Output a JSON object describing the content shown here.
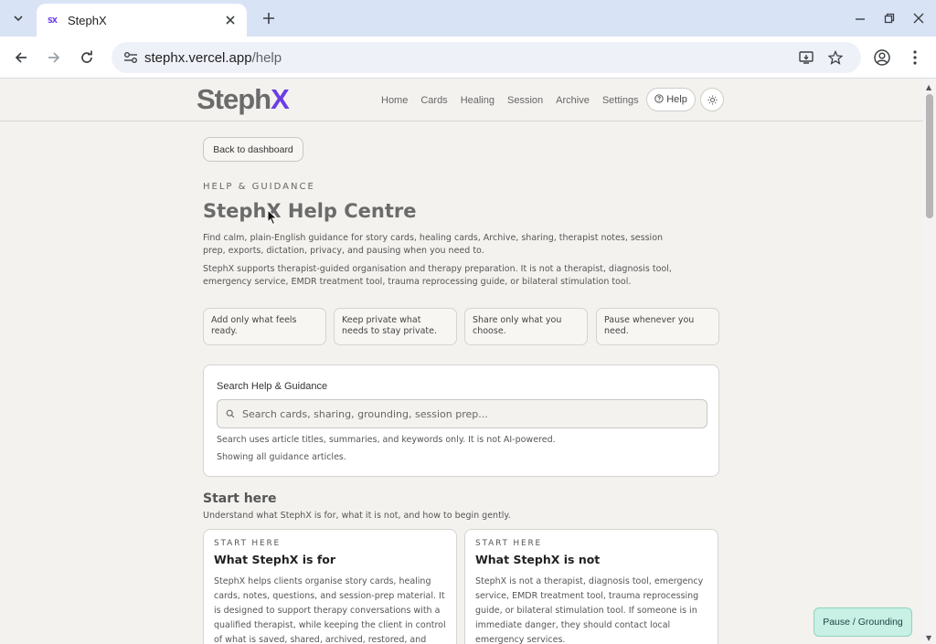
{
  "browser": {
    "tab_title": "StephX",
    "favicon_text": "SX",
    "url_host": "stephx.vercel.app",
    "url_path": "/help"
  },
  "header": {
    "logo_main": "Steph",
    "logo_accent": "X",
    "nav": [
      "Home",
      "Cards",
      "Healing",
      "Session",
      "Archive",
      "Settings"
    ],
    "help_label": "Help"
  },
  "page": {
    "back_label": "Back to dashboard",
    "eyebrow": "HELP & GUIDANCE",
    "title": "StephX Help Centre",
    "intro_1": "Find calm, plain-English guidance for story cards, healing cards, Archive, sharing, therapist notes, session prep, exports, dictation, privacy, and pausing when you need to.",
    "intro_2": "StephX supports therapist-guided organisation and therapy preparation. It is not a therapist, diagnosis tool, emergency service, EMDR treatment tool, trauma reprocessing guide, or bilateral stimulation tool.",
    "pills": [
      "Add only what feels ready.",
      "Keep private what needs to stay private.",
      "Share only what you choose.",
      "Pause whenever you need."
    ]
  },
  "search": {
    "label": "Search Help & Guidance",
    "placeholder": "Search cards, sharing, grounding, session prep...",
    "note": "Search uses article titles, summaries, and keywords only. It is not AI-powered.",
    "status": "Showing all guidance articles."
  },
  "section": {
    "title": "Start here",
    "subtitle": "Understand what StephX is for, what it is not, and how to begin gently.",
    "articles": [
      {
        "tag": "START HERE",
        "title": "What StephX is for",
        "body": "StephX helps clients organise story cards, healing cards, notes, questions, and session-prep material. It is designed to support therapy conversations with a qualified therapist, while keeping the client in control of what is saved, shared, archived, restored, and"
      },
      {
        "tag": "START HERE",
        "title": "What StephX is not",
        "body": "StephX is not a therapist, diagnosis tool, emergency service, EMDR treatment tool, trauma reprocessing guide, or bilateral stimulation tool. If someone is in immediate danger, they should contact local emergency services."
      }
    ]
  },
  "pause_label": "Pause / Grounding"
}
